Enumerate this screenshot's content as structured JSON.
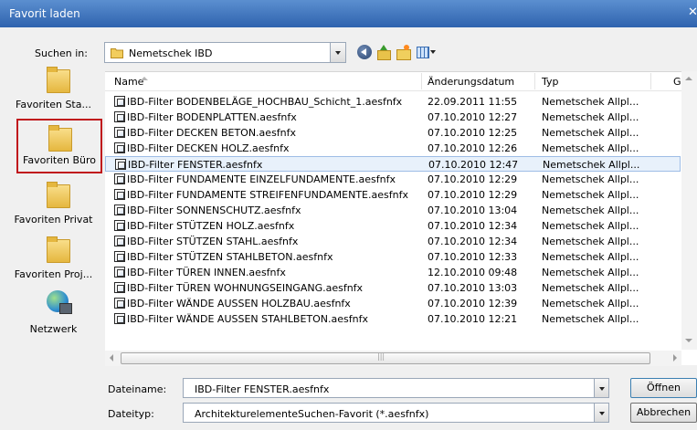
{
  "window": {
    "title": "Favorit laden",
    "close_label": "✕"
  },
  "toolbar": {
    "look_in_label": "Suchen in:",
    "look_in_value": "Nemetschek IBD"
  },
  "places": [
    {
      "label": "Favoriten Sta..."
    },
    {
      "label": "Favoriten Büro",
      "highlighted": true
    },
    {
      "label": "Favoriten Privat"
    },
    {
      "label": "Favoriten Proj..."
    },
    {
      "label": "Netzwerk"
    }
  ],
  "file_list": {
    "columns": [
      "Name",
      "Änderungsdatum",
      "Typ",
      "G"
    ],
    "selected_index": 4,
    "rows": [
      {
        "name": "IBD-Filter BODENBELÄGE_HOCHBAU_Schicht_1.aesfnfx",
        "date": "22.09.2011 11:55",
        "type": "Nemetschek Allpl..."
      },
      {
        "name": "IBD-Filter BODENPLATTEN.aesfnfx",
        "date": "07.10.2010 12:27",
        "type": "Nemetschek Allpl..."
      },
      {
        "name": "IBD-Filter DECKEN BETON.aesfnfx",
        "date": "07.10.2010 12:25",
        "type": "Nemetschek Allpl..."
      },
      {
        "name": "IBD-Filter DECKEN HOLZ.aesfnfx",
        "date": "07.10.2010 12:26",
        "type": "Nemetschek Allpl..."
      },
      {
        "name": "IBD-Filter FENSTER.aesfnfx",
        "date": "07.10.2010 12:47",
        "type": "Nemetschek Allpl..."
      },
      {
        "name": "IBD-Filter FUNDAMENTE EINZELFUNDAMENTE.aesfnfx",
        "date": "07.10.2010 12:29",
        "type": "Nemetschek Allpl..."
      },
      {
        "name": "IBD-Filter FUNDAMENTE STREIFENFUNDAMENTE.aesfnfx",
        "date": "07.10.2010 12:29",
        "type": "Nemetschek Allpl..."
      },
      {
        "name": "IBD-Filter SONNENSCHUTZ.aesfnfx",
        "date": "07.10.2010 13:04",
        "type": "Nemetschek Allpl..."
      },
      {
        "name": "IBD-Filter STÜTZEN HOLZ.aesfnfx",
        "date": "07.10.2010 12:34",
        "type": "Nemetschek Allpl..."
      },
      {
        "name": "IBD-Filter STÜTZEN STAHL.aesfnfx",
        "date": "07.10.2010 12:34",
        "type": "Nemetschek Allpl..."
      },
      {
        "name": "IBD-Filter STÜTZEN STAHLBETON.aesfnfx",
        "date": "07.10.2010 12:33",
        "type": "Nemetschek Allpl..."
      },
      {
        "name": "IBD-Filter TÜREN INNEN.aesfnfx",
        "date": "12.10.2010 09:48",
        "type": "Nemetschek Allpl..."
      },
      {
        "name": "IBD-Filter TÜREN WOHNUNGSEINGANG.aesfnfx",
        "date": "07.10.2010 13:03",
        "type": "Nemetschek Allpl..."
      },
      {
        "name": "IBD-Filter WÄNDE AUSSEN HOLZBAU.aesfnfx",
        "date": "07.10.2010 12:39",
        "type": "Nemetschek Allpl..."
      },
      {
        "name": "IBD-Filter WÄNDE AUSSEN STAHLBETON.aesfnfx",
        "date": "07.10.2010 12:21",
        "type": "Nemetschek Allpl..."
      }
    ]
  },
  "form": {
    "filename_label": "Dateiname:",
    "filename_value": "IBD-Filter FENSTER.aesfnfx",
    "filetype_label": "Dateityp:",
    "filetype_value": "ArchitekturelementeSuchen-Favorit (*.aesfnfx)"
  },
  "buttons": {
    "open": "Öffnen",
    "cancel": "Abbrechen"
  },
  "colors": {
    "title_bar": "#3a6fb7",
    "highlight_border": "#c0161c",
    "selection": "#e8f1fb"
  }
}
